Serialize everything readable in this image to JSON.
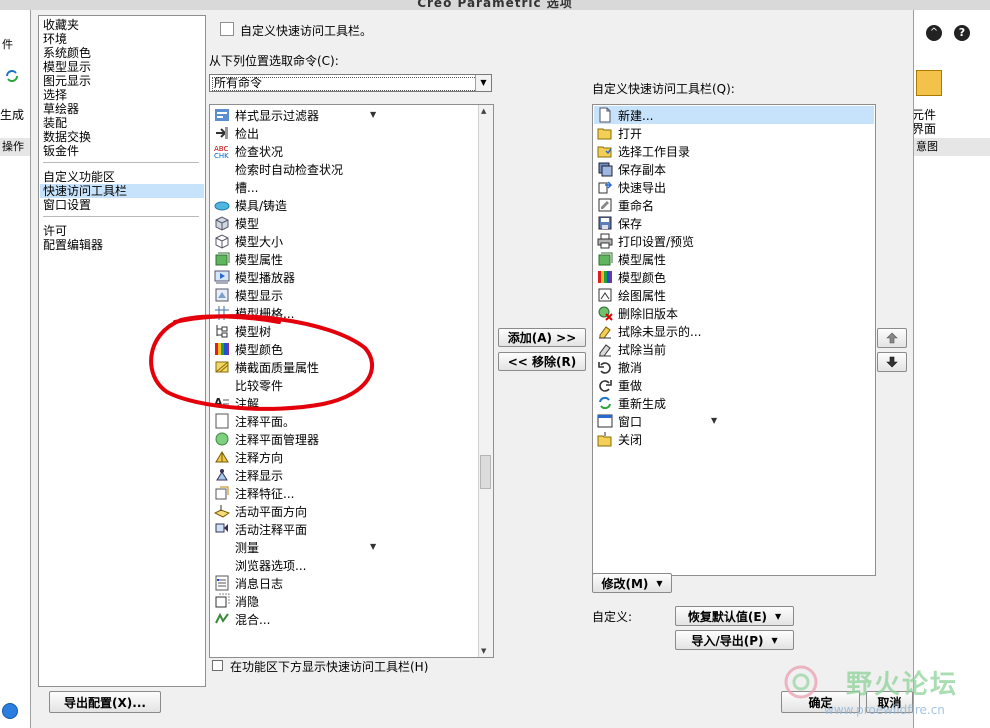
{
  "window": {
    "title": "Creo Parametric 选项"
  },
  "categories": {
    "group1": [
      "收藏夹",
      "环境",
      "系统颜色",
      "模型显示",
      "图元显示",
      "选择",
      "草绘器",
      "装配",
      "数据交换",
      "钣金件"
    ],
    "group2": [
      "自定义功能区",
      "快速访问工具栏",
      "窗口设置"
    ],
    "group3": [
      "许可",
      "配置编辑器"
    ],
    "selected": "快速访问工具栏"
  },
  "header": {
    "customize_label": "自定义快速访问工具栏。"
  },
  "source": {
    "label": "从下列位置选取命令(C):",
    "dropdown_value": "所有命令"
  },
  "commands": [
    {
      "label": "样式显示过滤器",
      "icon": "style-filter-icon",
      "submenu": true
    },
    {
      "label": "检出",
      "icon": "checkout-icon"
    },
    {
      "label": "检查状况",
      "icon": "abc-check-icon"
    },
    {
      "label": "检索时自动检查状况",
      "icon": ""
    },
    {
      "label": "槽...",
      "icon": ""
    },
    {
      "label": "模具/铸造",
      "icon": "mold-icon"
    },
    {
      "label": "模型",
      "icon": "model-icon"
    },
    {
      "label": "模型大小",
      "icon": "model-size-icon"
    },
    {
      "label": "模型属性",
      "icon": "model-properties-icon"
    },
    {
      "label": "模型播放器",
      "icon": "model-player-icon"
    },
    {
      "label": "模型显示",
      "icon": "model-display-icon"
    },
    {
      "label": "模型栅格...",
      "icon": "model-grid-icon"
    },
    {
      "label": "模型树",
      "icon": "model-tree-icon"
    },
    {
      "label": "模型颜色",
      "icon": "model-color-icon"
    },
    {
      "label": "横截面质量属性",
      "icon": "section-mass-icon"
    },
    {
      "label": "比较零件",
      "icon": ""
    },
    {
      "label": "注解",
      "icon": "annotation-icon"
    },
    {
      "label": "注释平面。",
      "icon": "annotation-plane-icon"
    },
    {
      "label": "注释平面管理器",
      "icon": "plane-manager-icon"
    },
    {
      "label": "注释方向",
      "icon": "annotation-orientation-icon"
    },
    {
      "label": "注释显示",
      "icon": "annotation-display-icon"
    },
    {
      "label": "注释特征...",
      "icon": "annotation-feature-icon"
    },
    {
      "label": "活动平面方向",
      "icon": "active-plane-icon"
    },
    {
      "label": "活动注释平面",
      "icon": "active-annotation-plane-icon"
    },
    {
      "label": "测量",
      "icon": "",
      "submenu": true
    },
    {
      "label": "浏览器选项...",
      "icon": ""
    },
    {
      "label": "消息日志",
      "icon": "message-log-icon"
    },
    {
      "label": "消隐",
      "icon": "hidden-line-icon"
    },
    {
      "label": "混合...",
      "icon": "blend-icon"
    }
  ],
  "toolbar_checkbox": {
    "label": "在功能区下方显示快速访问工具栏(H)"
  },
  "middle_buttons": {
    "add": "添加(A) >>",
    "remove": "<< 移除(R)"
  },
  "target": {
    "label": "自定义快速访问工具栏(Q):",
    "items": [
      {
        "label": "新建...",
        "icon": "new-file-icon",
        "selected": true
      },
      {
        "label": "打开",
        "icon": "open-folder-icon"
      },
      {
        "label": "选择工作目录",
        "icon": "working-directory-icon"
      },
      {
        "label": "保存副本",
        "icon": "save-copy-icon"
      },
      {
        "label": "快速导出",
        "icon": "quick-export-icon"
      },
      {
        "label": "重命名",
        "icon": "rename-icon"
      },
      {
        "label": "保存",
        "icon": "save-icon"
      },
      {
        "label": "打印设置/预览",
        "icon": "print-icon"
      },
      {
        "label": "模型属性",
        "icon": "model-properties-icon"
      },
      {
        "label": "模型颜色",
        "icon": "model-color-icon"
      },
      {
        "label": "绘图属性",
        "icon": "drawing-properties-icon"
      },
      {
        "label": "删除旧版本",
        "icon": "delete-old-versions-icon"
      },
      {
        "label": "拭除未显示的...",
        "icon": "erase-not-displayed-icon"
      },
      {
        "label": "拭除当前",
        "icon": "erase-current-icon"
      },
      {
        "label": "撤消",
        "icon": "undo-icon"
      },
      {
        "label": "重做",
        "icon": "redo-icon"
      },
      {
        "label": "重新生成",
        "icon": "regenerate-icon"
      },
      {
        "label": "窗口",
        "icon": "window-icon",
        "submenu": true
      },
      {
        "label": "关闭",
        "icon": "close-window-icon"
      }
    ]
  },
  "modify_button": "修改(M)",
  "customize": {
    "label": "自定义:",
    "restore": "恢复默认值(E)",
    "import_export": "导入/导出(P)"
  },
  "footer": {
    "export_config": "导出配置(X)...",
    "ok": "确定",
    "cancel": "取消"
  },
  "watermark": {
    "text": "野火论坛",
    "url": "www.proewildfire.cn"
  },
  "background": {
    "left_labels": [
      "件",
      "生成",
      "操作"
    ],
    "right_labels": [
      "元件",
      "界面",
      "意图"
    ]
  }
}
